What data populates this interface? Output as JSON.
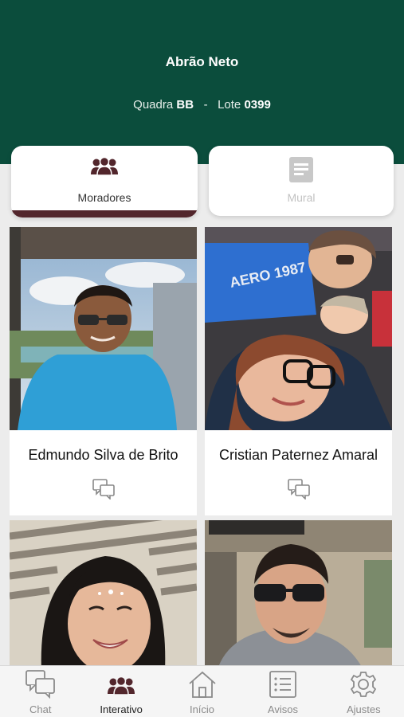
{
  "header": {
    "name": "Abrão Neto",
    "quadra_label": "Quadra",
    "quadra_value": "BB",
    "separator": "-",
    "lote_label": "Lote",
    "lote_value": "0399"
  },
  "tabs": [
    {
      "label": "Moradores",
      "icon": "group-icon",
      "active": true
    },
    {
      "label": "Mural",
      "icon": "document-icon",
      "active": false
    }
  ],
  "residents": [
    {
      "name": "Edmundo Silva de Brito"
    },
    {
      "name": "Cristian Paternez Amaral"
    },
    {
      "name": ""
    },
    {
      "name": ""
    }
  ],
  "nav": [
    {
      "label": "Chat",
      "icon": "chat-icon"
    },
    {
      "label": "Interativo",
      "icon": "group-icon",
      "active": true
    },
    {
      "label": "Início",
      "icon": "home-icon"
    },
    {
      "label": "Avisos",
      "icon": "list-icon"
    },
    {
      "label": "Ajustes",
      "icon": "gear-icon"
    }
  ],
  "colors": {
    "header": "#0b4d3c",
    "tab_bar": "#52262c",
    "icon_maroon": "#52262c"
  }
}
